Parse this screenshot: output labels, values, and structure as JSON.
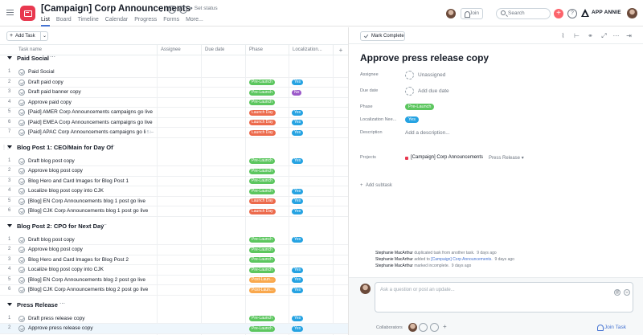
{
  "header": {
    "project_title": "[Campaign] Corp Announcements",
    "set_status": "Set status",
    "tabs": [
      "List",
      "Board",
      "Timeline",
      "Calendar",
      "Progress",
      "Forms",
      "More..."
    ],
    "join_label": "Join",
    "search_placeholder": "Search",
    "plus_glyph": "+",
    "help_glyph": "?",
    "workspace_name": "APP ANNIE"
  },
  "toolbar": {
    "add_task_label": "Add Task"
  },
  "columns": [
    "Task name",
    "Assignee",
    "Due date",
    "Phase",
    "Localization...",
    "+"
  ],
  "colors": {
    "pre_launch": "#5cc65f",
    "launch_day": "#ec6a4c",
    "post_launch": "#f9a84d",
    "yes": "#26a3e2",
    "no": "#9b59c9",
    "accent": "#4573d2",
    "brand": "#e8384f"
  },
  "sections": [
    {
      "title": "Paid Social",
      "tasks": [
        {
          "num": "1",
          "name": "Paid Social",
          "phase": "",
          "loc": ""
        },
        {
          "num": "2",
          "name": "Draft paid copy",
          "phase": "Pre-Launch",
          "phase_color": "#5cc65f",
          "loc": "Yes",
          "loc_color": "#26a3e2"
        },
        {
          "num": "3",
          "name": "Draft paid banner copy",
          "phase": "Pre-Launch",
          "phase_color": "#5cc65f",
          "loc": "No",
          "loc_color": "#9b59c9"
        },
        {
          "num": "4",
          "name": "Approve paid copy",
          "phase": "Pre-Launch",
          "phase_color": "#5cc65f",
          "loc": "",
          "loc_color": ""
        },
        {
          "num": "5",
          "name": "[Paid] AMER Corp Announcements campaigns go live",
          "phase": "Launch Day",
          "phase_color": "#ec6a4c",
          "loc": "Yes",
          "loc_color": "#26a3e2"
        },
        {
          "num": "6",
          "name": "[Paid] EMEA Corp Announcements campaigns go live",
          "phase": "Launch Day",
          "phase_color": "#ec6a4c",
          "loc": "Yes",
          "loc_color": "#26a3e2"
        },
        {
          "num": "7",
          "name": "[Paid] APAC Corp Announcements campaigns go li",
          "phase": "Launch Day",
          "phase_color": "#ec6a4c",
          "loc": "Yes",
          "loc_color": "#26a3e2",
          "subtasks": "5"
        }
      ]
    },
    {
      "title": "Blog Post 1: CEO/Main for Day Of",
      "tasks": [
        {
          "num": "1",
          "name": "Draft blog post copy",
          "phase": "Pre-Launch",
          "phase_color": "#5cc65f",
          "loc": "Yes",
          "loc_color": "#26a3e2"
        },
        {
          "num": "2",
          "name": "Approve blog post copy",
          "phase": "Pre-Launch",
          "phase_color": "#5cc65f",
          "loc": "",
          "loc_color": ""
        },
        {
          "num": "3",
          "name": "Blog Hero and Card Images for Blog Post 1",
          "phase": "Pre-Launch",
          "phase_color": "#5cc65f",
          "loc": "",
          "loc_color": ""
        },
        {
          "num": "4",
          "name": "Localize blog post copy into CJK",
          "phase": "Pre-Launch",
          "phase_color": "#5cc65f",
          "loc": "Yes",
          "loc_color": "#26a3e2"
        },
        {
          "num": "5",
          "name": "[Blog] EN Corp Announcements blog 1 post go live",
          "phase": "Launch Day",
          "phase_color": "#ec6a4c",
          "loc": "Yes",
          "loc_color": "#26a3e2"
        },
        {
          "num": "6",
          "name": "[Blog] CJK Corp Announcements blog 1 post go live",
          "phase": "Launch Day",
          "phase_color": "#ec6a4c",
          "loc": "Yes",
          "loc_color": "#26a3e2"
        }
      ]
    },
    {
      "title": "Blog Post 2: CPO for Next Day",
      "tasks": [
        {
          "num": "1",
          "name": "Draft blog post copy",
          "phase": "Pre-Launch",
          "phase_color": "#5cc65f",
          "loc": "Yes",
          "loc_color": "#26a3e2"
        },
        {
          "num": "2",
          "name": "Approve blog post copy",
          "phase": "Pre-Launch",
          "phase_color": "#5cc65f",
          "loc": "",
          "loc_color": ""
        },
        {
          "num": "3",
          "name": "Blog Hero and Card Images for Blog Post 2",
          "phase": "Pre-Launch",
          "phase_color": "#5cc65f",
          "loc": "",
          "loc_color": ""
        },
        {
          "num": "4",
          "name": "Localize blog post copy into CJK",
          "phase": "Pre-Launch",
          "phase_color": "#5cc65f",
          "loc": "Yes",
          "loc_color": "#26a3e2"
        },
        {
          "num": "5",
          "name": "[Blog] EN Corp Announcements blog 2 post go live",
          "phase": "Post-Laun...",
          "phase_color": "#f9a84d",
          "loc": "Yes",
          "loc_color": "#26a3e2"
        },
        {
          "num": "6",
          "name": "[Blog] CJK Corp Announcements blog 2 post go live",
          "phase": "Post-Laun...",
          "phase_color": "#f9a84d",
          "loc": "Yes",
          "loc_color": "#26a3e2"
        }
      ]
    },
    {
      "title": "Press Release",
      "tasks": [
        {
          "num": "1",
          "name": "Draft press release copy",
          "phase": "Pre-Launch",
          "phase_color": "#5cc65f",
          "loc": "Yes",
          "loc_color": "#26a3e2"
        },
        {
          "num": "2",
          "name": "Approve press release copy",
          "phase": "Pre-Launch",
          "phase_color": "#5cc65f",
          "loc": "Yes",
          "loc_color": "#26a3e2",
          "selected": true
        }
      ]
    }
  ],
  "detail": {
    "mark_complete": "Mark Complete",
    "title": "Approve press release copy",
    "fields": {
      "assignee_label": "Assignee",
      "assignee_value": "Unassigned",
      "due_label": "Due date",
      "due_value": "Add due date",
      "phase_label": "Phase",
      "phase_value": "Pre-Launch",
      "loc_label": "Localization Nee...",
      "loc_value": "Yes",
      "description_label": "Description",
      "description_placeholder": "Add a description...",
      "projects_label": "Projects",
      "project_name": "[Campaign] Corp Announcements",
      "project_section": "Press Release",
      "section_chevron": "▾"
    },
    "add_subtask": "Add subtask",
    "activity": [
      {
        "who": "Stephanie MacArthur",
        "what": "duplicated task from another task.",
        "link": "",
        "when": "9 days ago"
      },
      {
        "who": "Stephanie MacArthur",
        "what": "added to",
        "link": "[Campaign] Corp Announcements.",
        "when": "9 days ago"
      },
      {
        "who": "Stephanie MacArthur",
        "what": "marked incomplete.",
        "link": "",
        "when": "9 days ago"
      }
    ],
    "comment_placeholder": "Ask a question or post an update...",
    "collaborators_label": "Collaborators",
    "add_collab_glyph": "+",
    "join_task": "Join Task"
  }
}
